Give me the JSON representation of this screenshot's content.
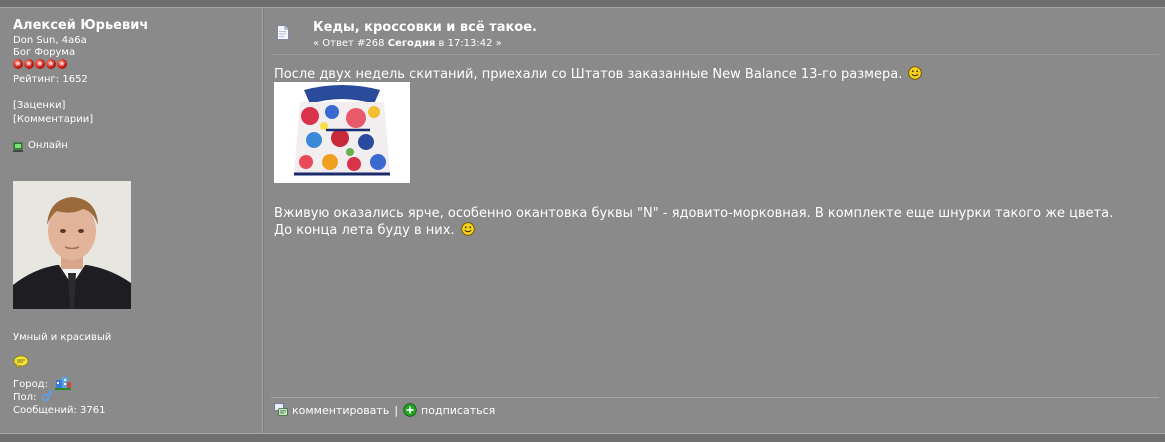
{
  "author": {
    "name": "Алексей Юрьевич",
    "subtitle": "Don Sun, 4a6a",
    "rank": "Бог Форума",
    "stars": 5,
    "rating": "Рейтинг: 1652",
    "links": [
      "[Заценки]",
      "[Комментарии]"
    ],
    "status": "Онлайн",
    "motto": "Умный и красивый",
    "city_label": "Город:",
    "gender_label": "Пол:",
    "messages": "Сообщений: 3761"
  },
  "post": {
    "title": "Кеды, кроссовки и всё такое.",
    "meta_prefix": "« Ответ #268",
    "meta_day": "Сегодня",
    "meta_time": "в 17:13:42 »",
    "paragraph1": "После двух недель скитаний, приехали со Штатов заказанные New Balance 13-го размера.",
    "paragraph2_line1": "Вживую оказались ярче, особенно окантовка буквы \"N\" - ядовито-морковная. В комплекте еще шнурки такого же цвета.",
    "paragraph2_line2": "До конца лета буду в них."
  },
  "footer": {
    "comment": "комментировать",
    "separator": "|",
    "subscribe": "подписаться"
  },
  "icons": {
    "doc": "document-icon",
    "smile": "smiley-icon",
    "online": "online-computer-icon",
    "message": "speech-bubble-icon",
    "city": "building-icon",
    "gender": "male-icon",
    "comment": "comment-icon",
    "subscribe": "plus-circle-icon"
  },
  "colors": {
    "background": "#8a8a8a",
    "frame": "#6e6e6e",
    "text": "#ffffff",
    "star": "#c8201a",
    "online": "#2aa82a",
    "subscribe": "#22a622"
  }
}
